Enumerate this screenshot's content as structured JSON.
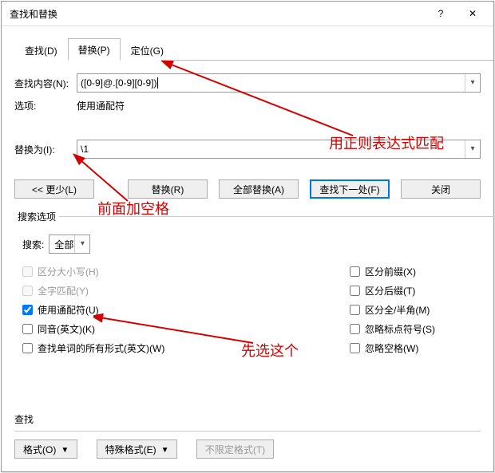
{
  "titlebar": {
    "title": "查找和替换",
    "help": "?",
    "close": "✕"
  },
  "tabs": {
    "find": "查找(D)",
    "replace": "替换(P)",
    "goto": "定位(G)"
  },
  "labels": {
    "find_what": "查找内容(N):",
    "options": "选项:",
    "options_value": "使用通配符",
    "replace_with": "替换为(I):"
  },
  "fields": {
    "find_value": "([0-9]@.[0-9][0-9])",
    "replace_value": " \\1"
  },
  "buttons": {
    "less": "<<  更少(L)",
    "replace": "替换(R)",
    "replace_all": "全部替换(A)",
    "find_next": "查找下一处(F)",
    "close": "关闭",
    "format": "格式(O)",
    "special": "特殊格式(E)",
    "noformat": "不限定格式(T)"
  },
  "search_options": {
    "legend": "搜索选项",
    "search_label": "搜索:",
    "direction": "全部",
    "match_case": "区分大小写(H)",
    "whole_word": "全字匹配(Y)",
    "wildcards": "使用通配符(U)",
    "sounds_like": "同音(英文)(K)",
    "word_forms": "查找单词的所有形式(英文)(W)",
    "match_prefix": "区分前缀(X)",
    "match_suffix": "区分后缀(T)",
    "half_full": "区分全/半角(M)",
    "ignore_punct": "忽略标点符号(S)",
    "ignore_space": "忽略空格(W)"
  },
  "checked": {
    "wildcards": true
  },
  "footer": {
    "title": "查找"
  },
  "annotations": {
    "a1": "用正则表达式匹配",
    "a2": "前面加空格",
    "a3": "先选这个"
  }
}
